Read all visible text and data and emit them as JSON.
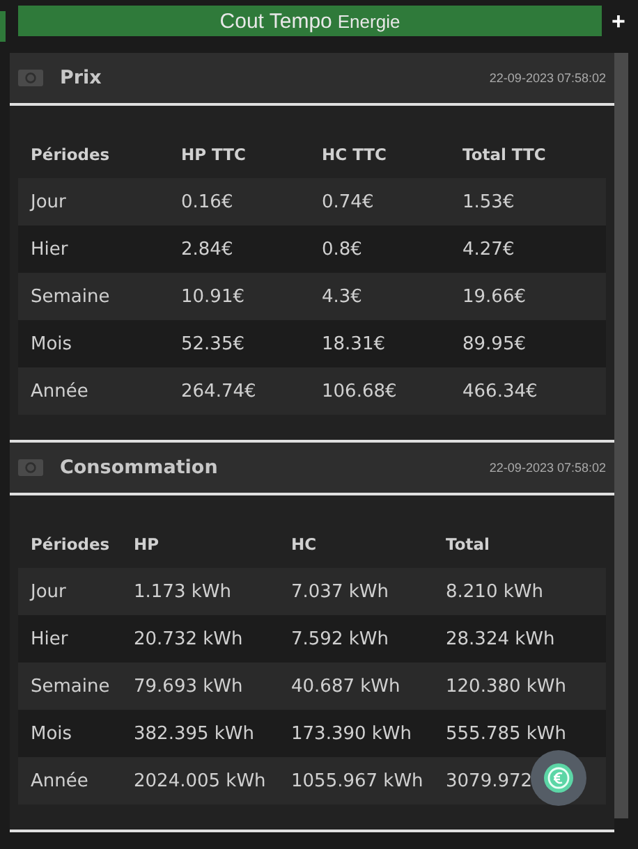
{
  "header": {
    "title": "Cout Tempo",
    "subtitle": "Energie",
    "add": "+"
  },
  "panels": [
    {
      "title": "Prix",
      "timestamp": "22-09-2023 07:58:02",
      "columns": [
        "Périodes",
        "HP TTC",
        "HC TTC",
        "Total TTC"
      ],
      "rows": [
        [
          "Jour",
          "0.16€",
          "0.74€",
          "1.53€"
        ],
        [
          "Hier",
          "2.84€",
          "0.8€",
          "4.27€"
        ],
        [
          "Semaine",
          "10.91€",
          "4.3€",
          "19.66€"
        ],
        [
          "Mois",
          "52.35€",
          "18.31€",
          "89.95€"
        ],
        [
          "Année",
          "264.74€",
          "106.68€",
          "466.34€"
        ]
      ]
    },
    {
      "title": "Consommation",
      "timestamp": "22-09-2023 07:58:02",
      "columns": [
        "Périodes",
        "HP",
        "HC",
        "Total"
      ],
      "rows": [
        [
          "Jour",
          "1.173 kWh",
          "7.037 kWh",
          "8.210 kWh"
        ],
        [
          "Hier",
          "20.732 kWh",
          "7.592 kWh",
          "28.324 kWh"
        ],
        [
          "Semaine",
          "79.693 kWh",
          "40.687 kWh",
          "120.380 kWh"
        ],
        [
          "Mois",
          "382.395 kWh",
          "173.390 kWh",
          "555.785 kWh"
        ],
        [
          "Année",
          "2024.005 kWh",
          "1055.967 kWh",
          "3079.972"
        ]
      ]
    }
  ]
}
